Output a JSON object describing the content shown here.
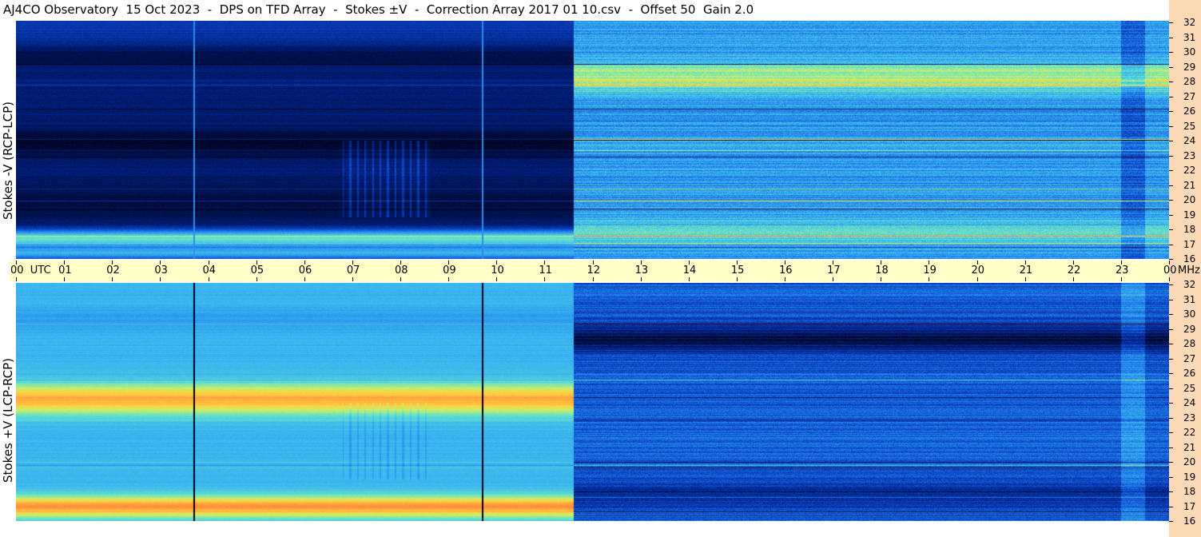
{
  "title": "AJ4CO Observatory  15 Oct 2023  -  DPS on TFD Array  -  Stokes ±V  -  Correction Array 2017 01 10.csv  -  Offset 50  Gain 2.0",
  "colors": {
    "timebar_bg": "#ffffc8",
    "freq_bg": "#fcd9b6",
    "colormap": [
      "#000010",
      "#001a6e",
      "#0a3fbf",
      "#1e7ae8",
      "#3ab4f0",
      "#60e0d0",
      "#c8f068",
      "#ffd040",
      "#ff8a3c",
      "#ff3c7a"
    ]
  },
  "chart_data": [
    {
      "type": "heatmap",
      "ylabel": "Stokes -V (RCP-LCP)",
      "xlim": [
        0,
        24
      ],
      "ylim": [
        16,
        32
      ],
      "yticks": [
        "16",
        "17",
        "18",
        "19",
        "20",
        "21",
        "22",
        "23",
        "24",
        "25",
        "26",
        "27",
        "28",
        "29",
        "30",
        "31",
        "32"
      ],
      "vertical_lines_utc": [
        3.7,
        9.7
      ],
      "mode_change_utc": 11.6
    },
    {
      "type": "heatmap",
      "ylabel": "Stokes +V (LCP-RCP)",
      "xlim": [
        0,
        24
      ],
      "ylim": [
        16,
        32
      ],
      "yticks": [
        "16",
        "17",
        "18",
        "19",
        "20",
        "21",
        "22",
        "23",
        "24",
        "25",
        "26",
        "27",
        "28",
        "29",
        "30",
        "31",
        "32"
      ],
      "vertical_lines_utc": [
        3.7,
        9.7
      ],
      "mode_change_utc": 11.6
    }
  ],
  "time_axis": {
    "labels": [
      "00  UTC",
      "01",
      "02",
      "03",
      "04",
      "05",
      "06",
      "07",
      "08",
      "09",
      "10",
      "11",
      "12",
      "13",
      "14",
      "15",
      "16",
      "17",
      "18",
      "19",
      "20",
      "21",
      "22",
      "23",
      "00"
    ],
    "unit": "MHz"
  }
}
